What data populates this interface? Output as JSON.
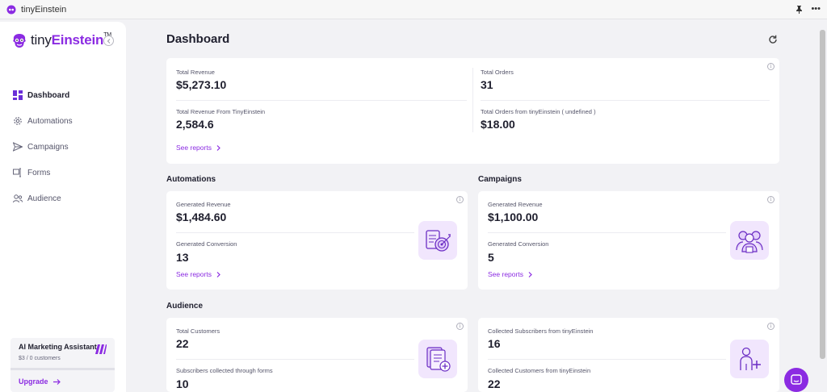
{
  "window": {
    "title": "tinyEinstein",
    "more_label": "•••"
  },
  "brand": {
    "prefix": "tiny",
    "name": "Einstein",
    "tm": "TM"
  },
  "sidebar": {
    "items": [
      {
        "label": "Dashboard",
        "icon": "dashboard-icon"
      },
      {
        "label": "Automations",
        "icon": "gear-icon"
      },
      {
        "label": "Campaigns",
        "icon": "send-icon"
      },
      {
        "label": "Forms",
        "icon": "form-icon"
      },
      {
        "label": "Audience",
        "icon": "users-icon"
      }
    ],
    "assistant": {
      "title": "AI Marketing Assistant",
      "subtitle": "$3 / 0 customers",
      "upgrade_label": "Upgrade",
      "progress": 0
    }
  },
  "page": {
    "title": "Dashboard"
  },
  "overview": {
    "total_revenue_label": "Total Revenue",
    "total_revenue_value": "$5,273.10",
    "total_orders_label": "Total Orders",
    "total_orders_value": "31",
    "te_revenue_label": "Total Revenue From TinyEinstein",
    "te_revenue_value": "2,584.6",
    "te_orders_label": "Total Orders from tinyEinstein ( undefined )",
    "te_orders_value": "$18.00",
    "see_reports": "See reports"
  },
  "automations": {
    "section_title": "Automations",
    "gen_revenue_label": "Generated Revenue",
    "gen_revenue_value": "$1,484.60",
    "gen_conversion_label": "Generated Conversion",
    "gen_conversion_value": "13",
    "see_reports": "See reports"
  },
  "campaigns": {
    "section_title": "Campaigns",
    "gen_revenue_label": "Generated Revenue",
    "gen_revenue_value": "$1,100.00",
    "gen_conversion_label": "Generated Conversion",
    "gen_conversion_value": "5",
    "see_reports": "See reports"
  },
  "audience": {
    "section_title": "Audience",
    "total_customers_label": "Total Customers",
    "total_customers_value": "22",
    "subs_forms_label": "Subscribers collected through forms",
    "subs_forms_value": "10",
    "collected_subs_label": "Collected Subscribers from tinyEinstein",
    "collected_subs_value": "16",
    "collected_customers_label": "Collected Customers from tinyEinstein",
    "collected_customers_value": "22"
  },
  "colors": {
    "accent": "#8b2be2",
    "accent_light": "#f1e6fd",
    "background": "#f2f2f5"
  }
}
